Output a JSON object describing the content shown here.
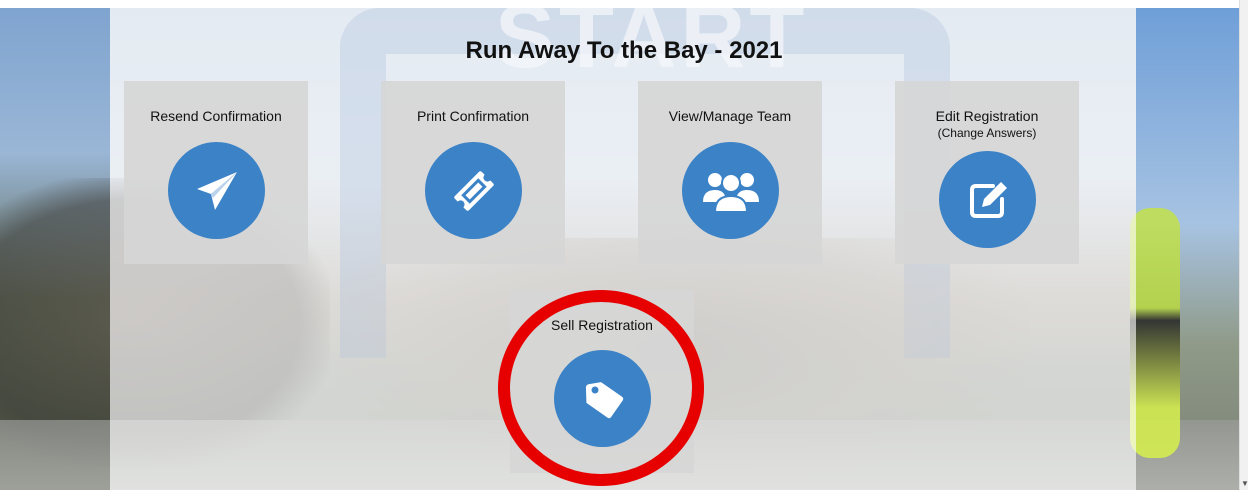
{
  "page": {
    "title": "Run Away To the Bay - 2021"
  },
  "cards": {
    "resend": {
      "label": "Resend Confirmation",
      "icon": "paper-plane-icon"
    },
    "print": {
      "label": "Print Confirmation",
      "icon": "ticket-icon"
    },
    "team": {
      "label": "View/Manage Team",
      "icon": "users-icon"
    },
    "edit": {
      "label": "Edit Registration",
      "sublabel": "(Change Answers)",
      "icon": "edit-icon"
    },
    "sell": {
      "label": "Sell Registration",
      "icon": "tag-icon"
    }
  },
  "colors": {
    "accent": "#3b82c7",
    "highlight_ring": "#e60000",
    "card_bg": "#d6d6d6"
  }
}
